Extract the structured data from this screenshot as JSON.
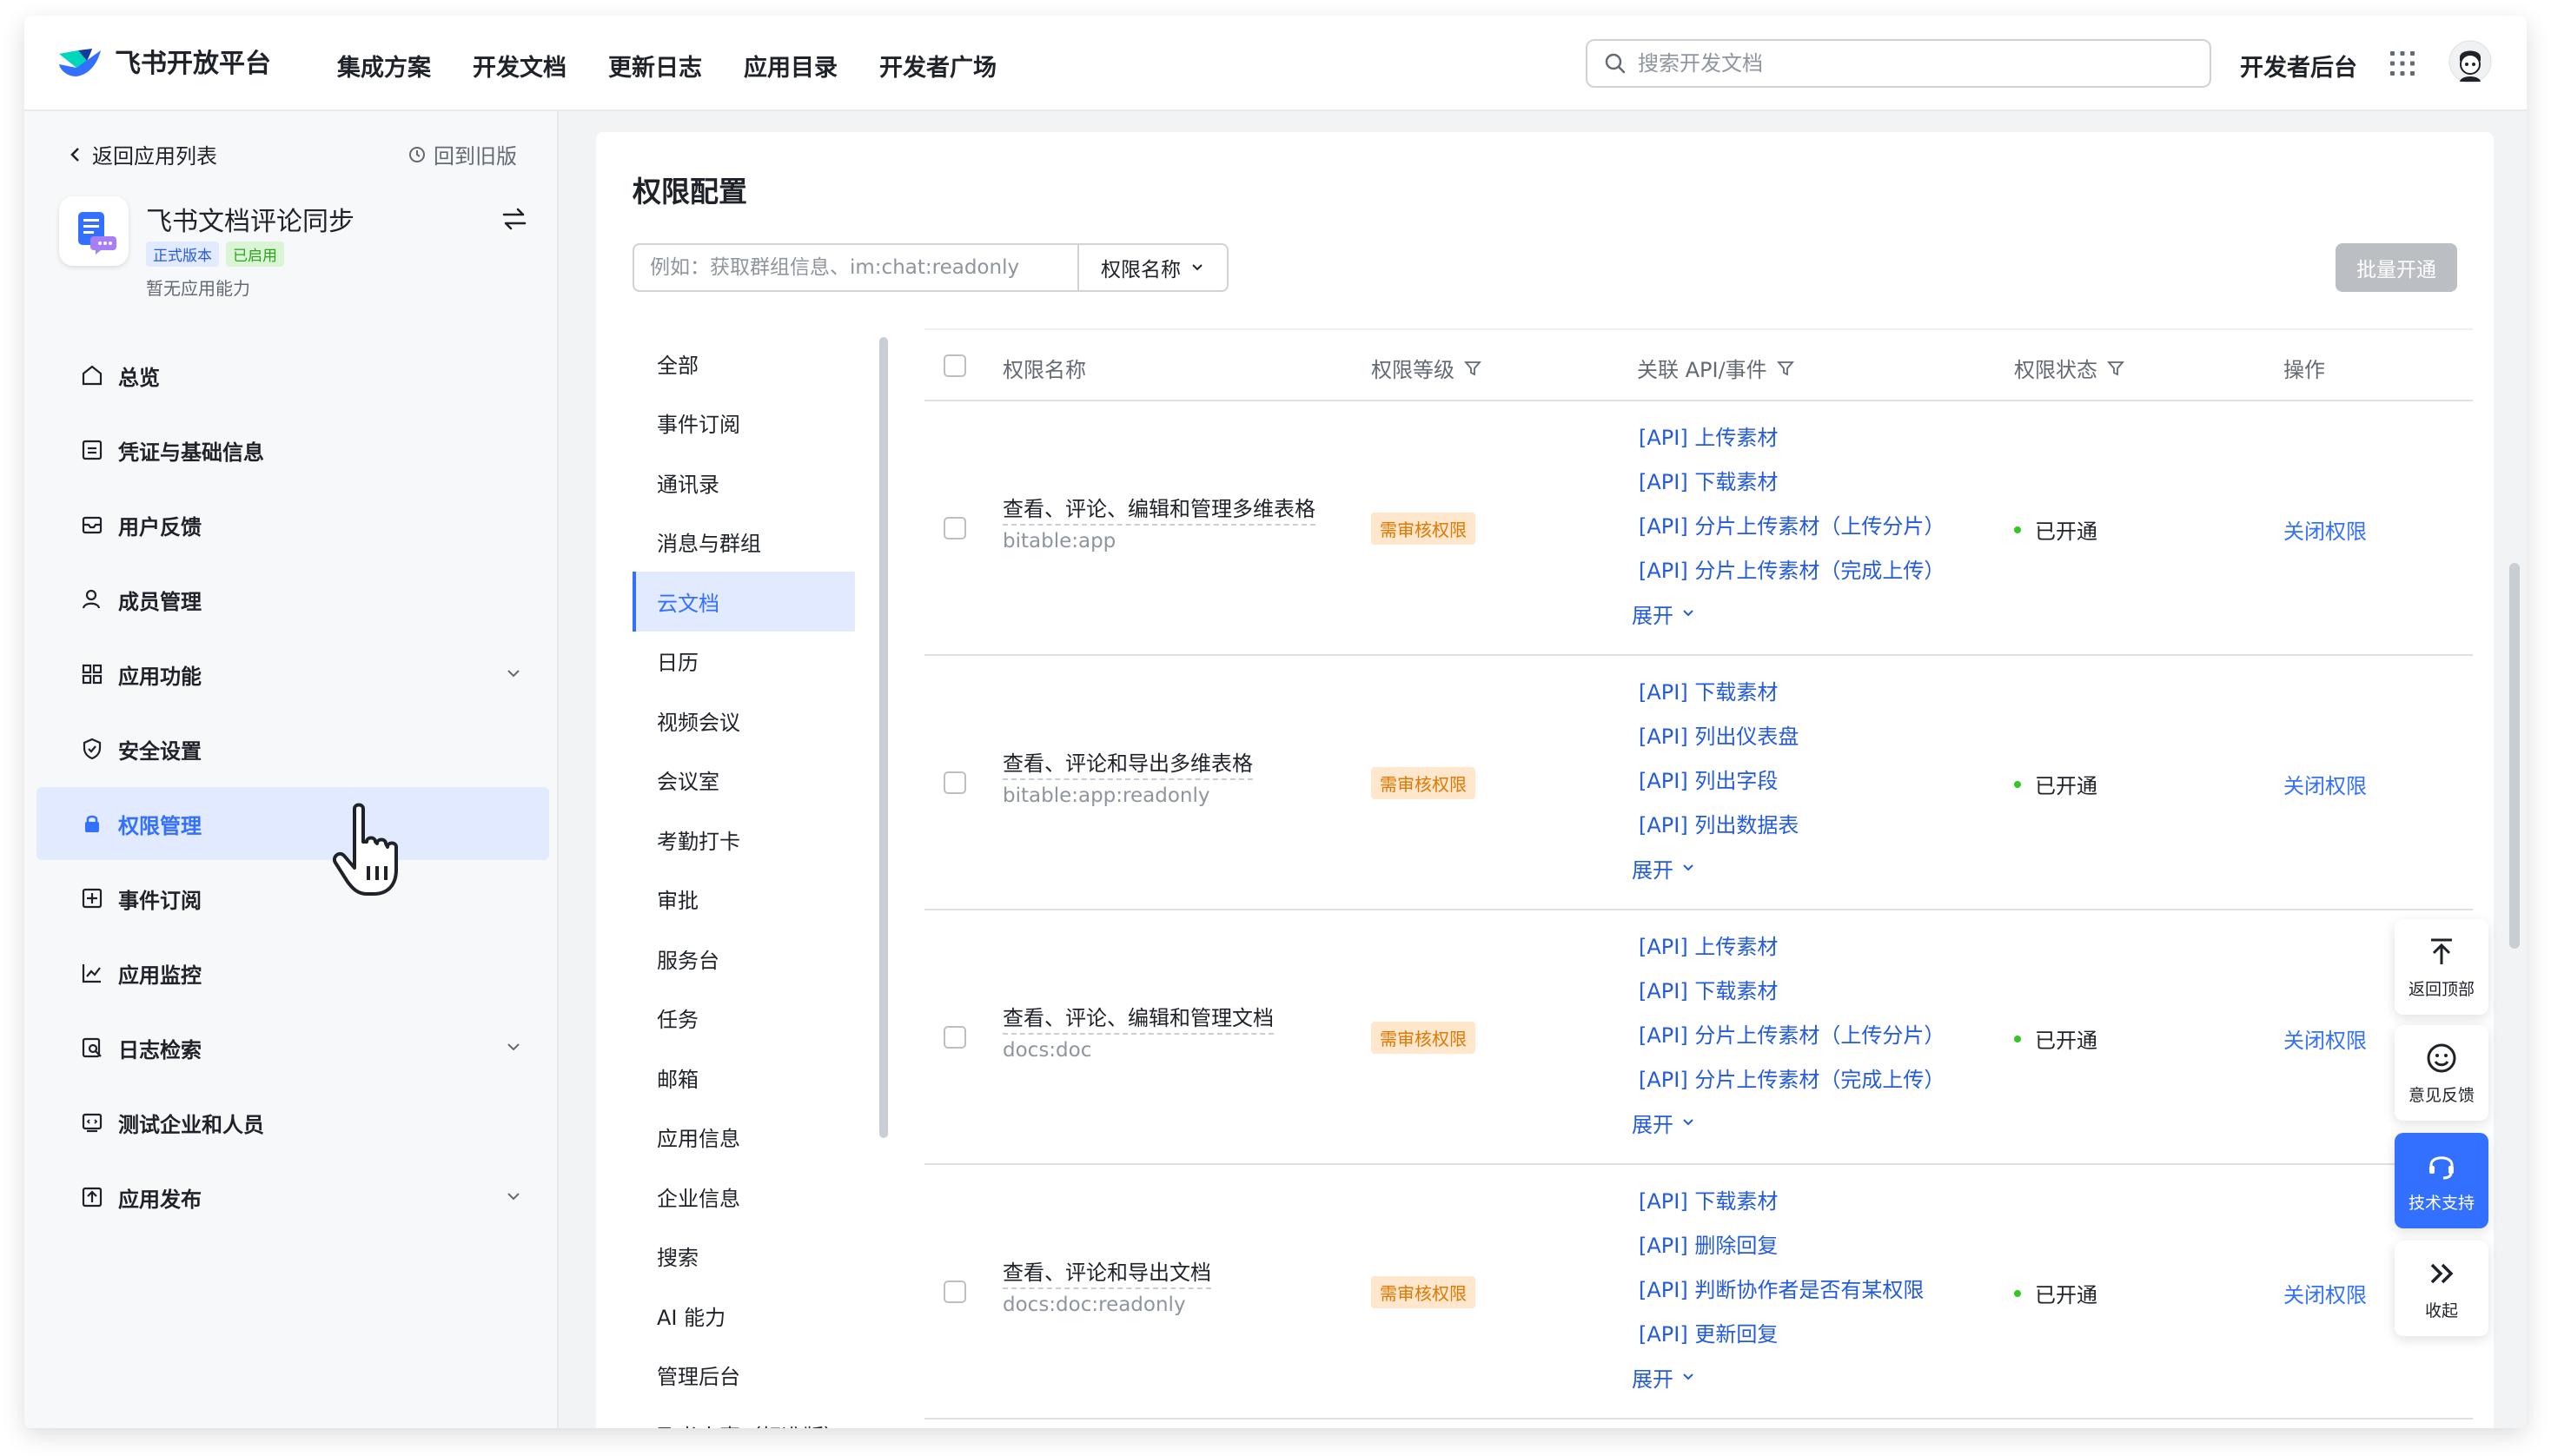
{
  "header": {
    "brand": "飞书开放平台",
    "nav": [
      "集成方案",
      "开发文档",
      "更新日志",
      "应用目录",
      "开发者广场"
    ],
    "search_placeholder": "搜索开发文档",
    "developer_console": "开发者后台"
  },
  "sidebar": {
    "back": "返回应用列表",
    "old_version": "回到旧版",
    "app_name": "飞书文档评论同步",
    "badges": [
      "正式版本",
      "已启用"
    ],
    "app_subtitle": "暂无应用能力",
    "items": [
      {
        "label": "总览",
        "icon": "home-icon"
      },
      {
        "label": "凭证与基础信息",
        "icon": "credential-icon"
      },
      {
        "label": "用户反馈",
        "icon": "mail-icon"
      },
      {
        "label": "成员管理",
        "icon": "user-icon"
      },
      {
        "label": "应用功能",
        "icon": "apps-icon",
        "expandable": true
      },
      {
        "label": "安全设置",
        "icon": "shield-icon"
      },
      {
        "label": "权限管理",
        "icon": "lock-icon",
        "active": true
      },
      {
        "label": "事件订阅",
        "icon": "event-icon"
      },
      {
        "label": "应用监控",
        "icon": "chart-icon"
      },
      {
        "label": "日志检索",
        "icon": "log-search-icon",
        "expandable": true
      },
      {
        "label": "测试企业和人员",
        "icon": "test-icon"
      },
      {
        "label": "应用发布",
        "icon": "publish-icon",
        "expandable": true
      }
    ]
  },
  "content": {
    "title": "权限配置",
    "filter_placeholder": "例如：获取群组信息、im:chat:readonly",
    "filter_select": "权限名称",
    "batch_button": "批量开通",
    "categories": [
      "全部",
      "事件订阅",
      "通讯录",
      "消息与群组",
      "云文档",
      "日历",
      "视频会议",
      "会议室",
      "考勤打卡",
      "审批",
      "服务台",
      "任务",
      "邮箱",
      "应用信息",
      "企业信息",
      "搜索",
      "AI 能力",
      "管理后台",
      "飞书人事（标准版）"
    ],
    "active_category": "云文档",
    "columns": [
      "权限名称",
      "权限等级",
      "关联 API/事件",
      "权限状态",
      "操作"
    ],
    "rows": [
      {
        "name": "查看、评论、编辑和管理多维表格",
        "code": "bitable:app",
        "level": "需审核权限",
        "apis": [
          "[API] 上传素材",
          "[API] 下载素材",
          "[API] 分片上传素材（上传分片）",
          "[API] 分片上传素材（完成上传）"
        ],
        "expand": "展开",
        "status": "已开通",
        "action": "关闭权限"
      },
      {
        "name": "查看、评论和导出多维表格",
        "code": "bitable:app:readonly",
        "level": "需审核权限",
        "apis": [
          "[API] 下载素材",
          "[API] 列出仪表盘",
          "[API] 列出字段",
          "[API] 列出数据表"
        ],
        "expand": "展开",
        "status": "已开通",
        "action": "关闭权限"
      },
      {
        "name": "查看、评论、编辑和管理文档",
        "code": "docs:doc",
        "level": "需审核权限",
        "apis": [
          "[API] 上传素材",
          "[API] 下载素材",
          "[API] 分片上传素材（上传分片）",
          "[API] 分片上传素材（完成上传）"
        ],
        "expand": "展开",
        "status": "已开通",
        "action": "关闭权限"
      },
      {
        "name": "查看、评论和导出文档",
        "code": "docs:doc:readonly",
        "level": "需审核权限",
        "apis": [
          "[API] 下载素材",
          "[API] 删除回复",
          "[API] 判断协作者是否有某权限",
          "[API] 更新回复"
        ],
        "expand": "展开",
        "status": "已开通",
        "action": "关闭权限"
      }
    ]
  },
  "float_buttons": [
    "返回顶部",
    "意见反馈",
    "技术支持",
    "收起"
  ],
  "colors": {
    "primary": "#3370ff",
    "link": "#245bdb",
    "tag_bg": "#fee7cd",
    "tag_text": "#de7802",
    "status_dot": "#34c724"
  }
}
